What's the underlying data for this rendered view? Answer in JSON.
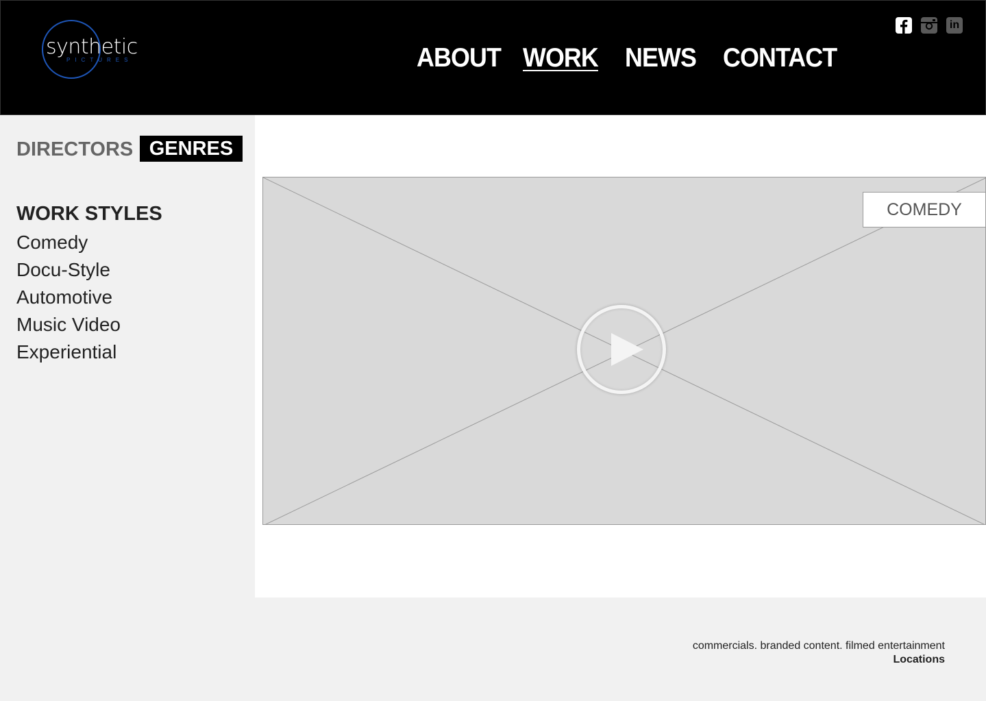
{
  "brand": {
    "logo_word": "synthetic",
    "logo_sub": "PICTURES"
  },
  "nav": {
    "items": [
      {
        "label": "ABOUT"
      },
      {
        "label": "WORK",
        "active": true
      },
      {
        "label": "NEWS"
      },
      {
        "label": "CONTACT"
      }
    ]
  },
  "social": {
    "icons": [
      "facebook-icon",
      "instagram-icon",
      "linkedin-icon"
    ],
    "linkedin_glyph": "in"
  },
  "sidebar": {
    "tabs": [
      {
        "label": "DIRECTORS",
        "active": false
      },
      {
        "label": "GENRES",
        "active": true
      }
    ],
    "section_heading": "WORK STYLES",
    "items": [
      "Comedy",
      "Docu-Style",
      "Automotive",
      "Music Video",
      "Experiential"
    ]
  },
  "video": {
    "genre_tag": "COMEDY",
    "play_icon": "play-icon"
  },
  "footer": {
    "tagline": "commercials. branded content. filmed entertainment",
    "link": "Locations"
  },
  "colors": {
    "header_bg": "#000000",
    "logo_accent": "#1e56b8",
    "sidebar_bg": "#f1f1f1",
    "video_placeholder": "#d9d9d9"
  }
}
